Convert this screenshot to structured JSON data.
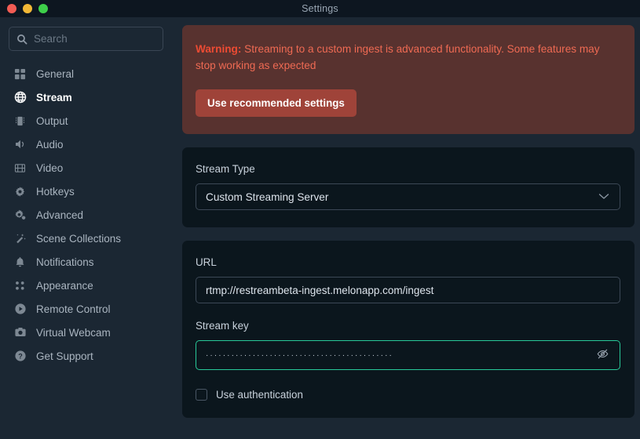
{
  "window": {
    "title": "Settings",
    "traffic_lights": [
      {
        "name": "close",
        "color": "#f25c54"
      },
      {
        "name": "minimize",
        "color": "#f2b836"
      },
      {
        "name": "maximize",
        "color": "#3ecf4a"
      }
    ]
  },
  "sidebar": {
    "search": {
      "placeholder": "Search",
      "value": "",
      "icon": "search-icon"
    },
    "items": [
      {
        "label": "General",
        "icon": "grid-icon",
        "active": false
      },
      {
        "label": "Stream",
        "icon": "globe-icon",
        "active": true
      },
      {
        "label": "Output",
        "icon": "chip-icon",
        "active": false
      },
      {
        "label": "Audio",
        "icon": "speaker-icon",
        "active": false
      },
      {
        "label": "Video",
        "icon": "film-icon",
        "active": false
      },
      {
        "label": "Hotkeys",
        "icon": "gear-icon",
        "active": false
      },
      {
        "label": "Advanced",
        "icon": "gears-icon",
        "active": false
      },
      {
        "label": "Scene Collections",
        "icon": "wand-icon",
        "active": false
      },
      {
        "label": "Notifications",
        "icon": "bell-icon",
        "active": false
      },
      {
        "label": "Appearance",
        "icon": "dots-icon",
        "active": false
      },
      {
        "label": "Remote Control",
        "icon": "play-circle-icon",
        "active": false
      },
      {
        "label": "Virtual Webcam",
        "icon": "camera-icon",
        "active": false
      },
      {
        "label": "Get Support",
        "icon": "question-circle-icon",
        "active": false
      }
    ]
  },
  "warning": {
    "prefix": "Warning:",
    "message": " Streaming to a custom ingest is advanced functionality. Some features may stop working as expected",
    "button_label": "Use recommended settings",
    "bg_color": "#58322f",
    "text_color": "#ef6a53",
    "button_color": "#9f4339"
  },
  "stream_type": {
    "label": "Stream Type",
    "value": "Custom Streaming Server",
    "chevron": "chevron-down-icon"
  },
  "server": {
    "url": {
      "label": "URL",
      "value": "rtmp://restreambeta-ingest.melonapp.com/ingest",
      "placeholder": ""
    },
    "stream_key": {
      "label": "Stream key",
      "masked_value": "············································",
      "reveal_icon": "eye-slash-icon",
      "focus_color": "#28c999"
    },
    "use_authentication": {
      "label": "Use authentication",
      "checked": false
    }
  }
}
